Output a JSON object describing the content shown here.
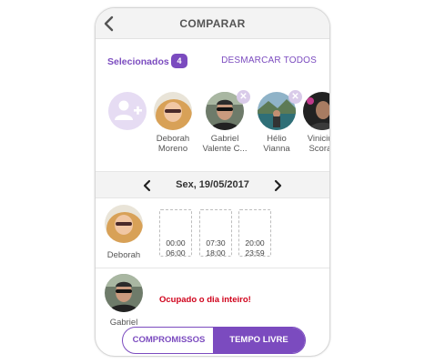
{
  "header": {
    "title": "COMPARAR",
    "back_icon": "chevron-left-icon"
  },
  "selection": {
    "label": "Selecionados",
    "count": "4",
    "unselect_all": "DESMARCAR TODOS"
  },
  "add_icon": "add-user-icon",
  "people": [
    {
      "line1": "Deborah",
      "line2": "Moreno",
      "removable": false
    },
    {
      "line1": "Gabriel",
      "line2": "Valente C...",
      "removable": true
    },
    {
      "line1": "Hélio",
      "line2": "Vianna",
      "removable": true
    },
    {
      "line1": "Vinicius",
      "line2": "Scorali",
      "removable": true
    }
  ],
  "remove_glyph": "✕",
  "date": {
    "label": "Sex, 19/05/2017",
    "prev_icon": "chevron-left-icon",
    "next_icon": "chevron-right-icon"
  },
  "schedule": [
    {
      "name": "Deborah",
      "slots": [
        {
          "start": "00:00",
          "end": "06:00"
        },
        {
          "start": "07:30",
          "end": "18:00"
        },
        {
          "start": "20:00",
          "end": "23:59"
        }
      ]
    },
    {
      "name": "Gabriel",
      "message": "Ocupado o dia inteiro!"
    }
  ],
  "tabs": {
    "commitments": "COMPROMISSOS",
    "free_time": "TEMPO LIVRE",
    "active": "free_time"
  },
  "colors": {
    "accent": "#7b4bbf",
    "busy": "#d0021b"
  }
}
